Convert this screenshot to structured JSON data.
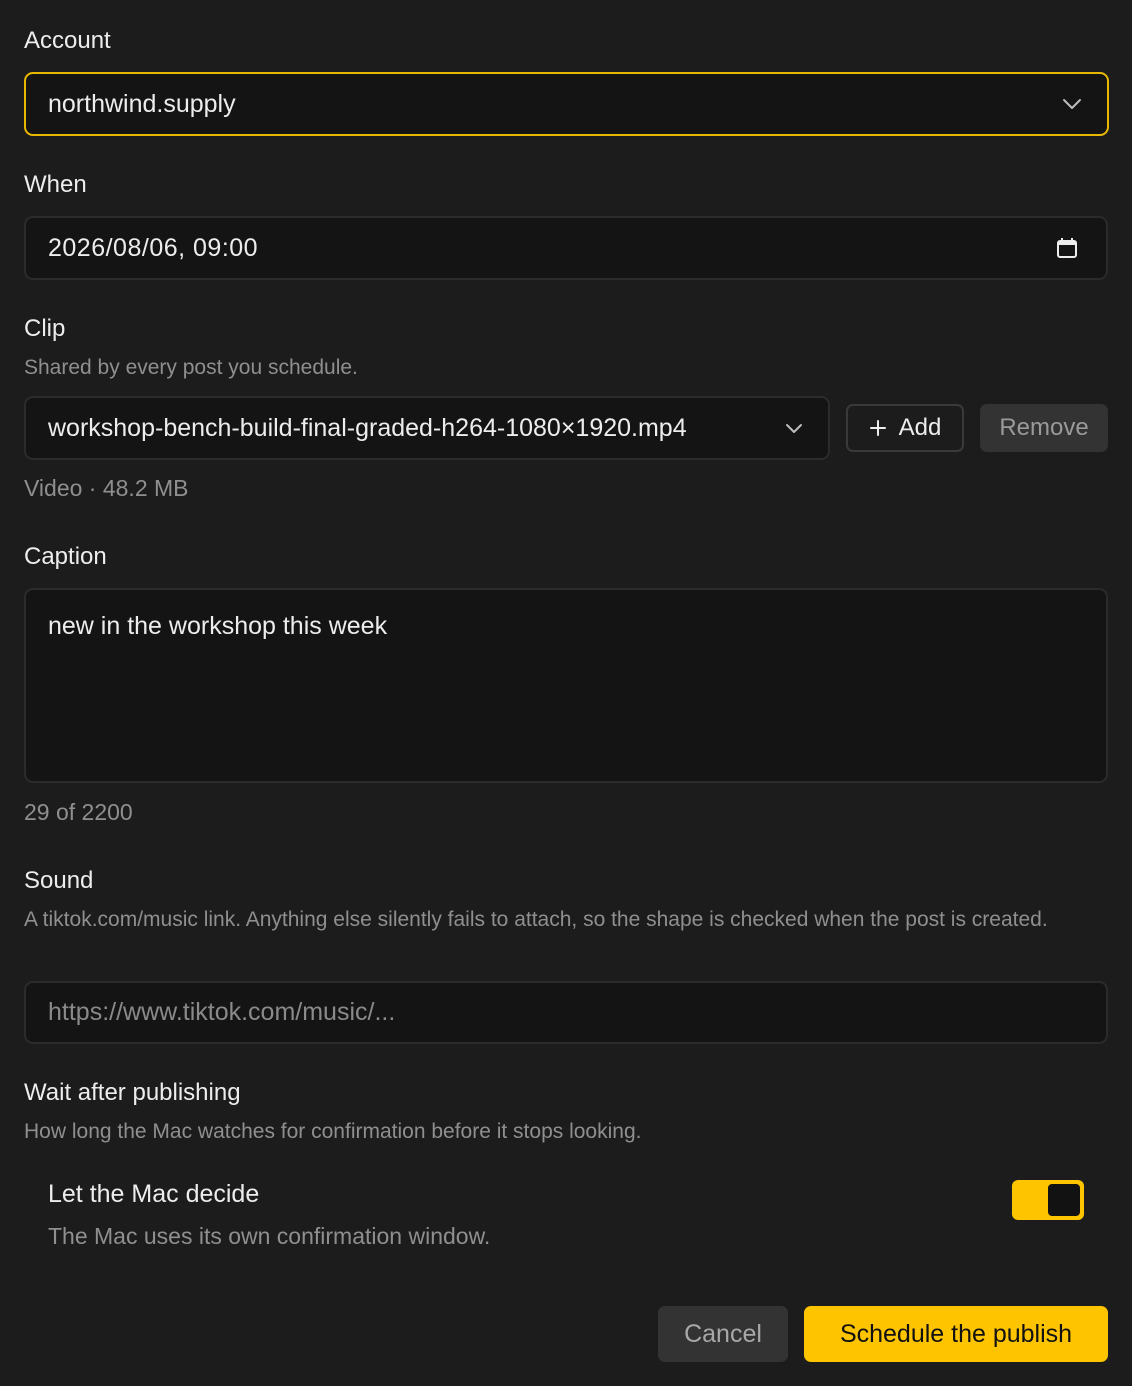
{
  "account": {
    "label": "Account",
    "value": "northwind.supply"
  },
  "when": {
    "label": "When",
    "value": "2026/08/06, 09:00"
  },
  "clip": {
    "label": "Clip",
    "hint": "Shared by every post you schedule.",
    "value": "workshop-bench-build-final-graded-h264-1080×1920.mp4",
    "add_label": "Add",
    "remove_label": "Remove",
    "meta": "Video · 48.2 MB"
  },
  "caption": {
    "label": "Caption",
    "value": "new in the workshop this week",
    "counter": "29 of 2200"
  },
  "sound": {
    "label": "Sound",
    "hint": "A tiktok.com/music link. Anything else silently fails to attach, so the shape is checked when the post is created.",
    "placeholder": "https://www.tiktok.com/music/..."
  },
  "wait": {
    "label": "Wait after publishing",
    "hint": "How long the Mac watches for confirmation before it stops looking.",
    "option_title": "Let the Mac decide",
    "option_desc": "The Mac uses its own confirmation window.",
    "toggle_on": true
  },
  "footer": {
    "cancel_label": "Cancel",
    "submit_label": "Schedule the publish"
  },
  "colors": {
    "accent": "#ffc400",
    "background": "#1c1c1c",
    "field": "#141414"
  },
  "icons": {
    "account_trailing": "chevron-down-icon",
    "when_trailing": "calendar-icon",
    "clip_trailing": "chevron-down-icon",
    "add_leading": "plus-icon"
  }
}
